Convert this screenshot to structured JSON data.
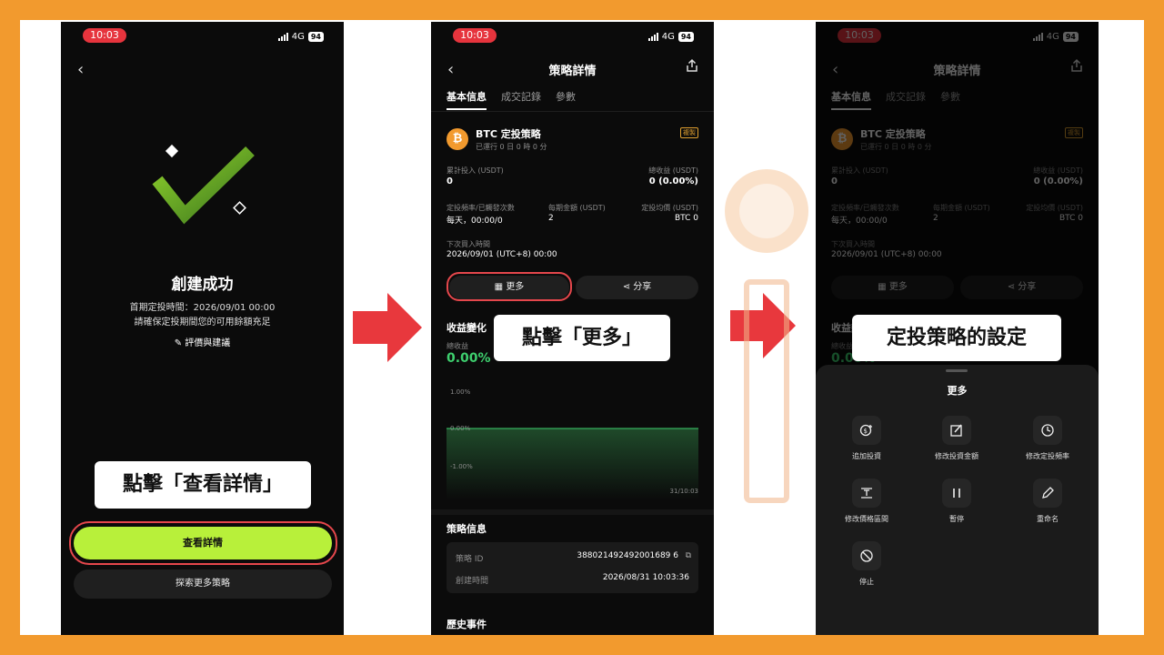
{
  "colors": {
    "frame": "#f29a2e",
    "accent_green": "#b8f03a",
    "highlight_red": "#e5474c",
    "arrow_red": "#e8383d",
    "positive_green": "#3ecf6e"
  },
  "status": {
    "time": "10:03",
    "network": "4G",
    "battery": "94"
  },
  "phone1": {
    "title": "創建成功",
    "first_invest_label": "首期定投時間：2026/09/01 00:00",
    "ensure_text": "請確保定投期間您的可用餘額充足",
    "feedback_link": "評價與建議",
    "view_details_button": "查看詳情",
    "explore_button": "探索更多策略",
    "callout": "點擊「查看詳情」"
  },
  "phone2": {
    "header_title": "策略詳情",
    "tabs": [
      "基本信息",
      "成交記錄",
      "參數"
    ],
    "strategy_name": "BTC 定投策略",
    "running_time": "已運行 0 日 0 時 0 分",
    "tag": "複製",
    "cumulative_label": "累計投入 (USDT)",
    "cumulative_value": "0",
    "total_profit_label": "總收益 (USDT)",
    "total_profit_value": "0 (0.00%)",
    "freq_label": "定投頻率/已觸發次數",
    "freq_value": "每天，00:00/0",
    "amount_label": "每期金額 (USDT)",
    "amount_value": "2",
    "avg_label": "定投均價 (USDT)",
    "avg_value": "BTC 0",
    "next_label": "下次買入時間",
    "next_value": "2026/09/01 (UTC+8) 00:00",
    "more_button": "更多",
    "share_button": "分享",
    "profit_section": "收益變化",
    "total_profit_small": "總收益",
    "profit_pct": "0.00%",
    "y_ticks": [
      "1.00%",
      "0.00%",
      "-1.00%"
    ],
    "x_tick": "31/10:03",
    "info_section": "策略信息",
    "strategy_id_label": "策略 ID",
    "strategy_id_value": "388021492492001689 6",
    "created_label": "創建時間",
    "created_value": "2026/08/31 10:03:36",
    "history_section": "歷史事件",
    "callout": "點擊「更多」"
  },
  "phone3": {
    "sheet_title": "更多",
    "actions": [
      "追加投資",
      "修改投資金額",
      "修改定投頻率",
      "修改價格區間",
      "暫停",
      "重命名",
      "停止"
    ],
    "callout": "定投策略的設定"
  }
}
